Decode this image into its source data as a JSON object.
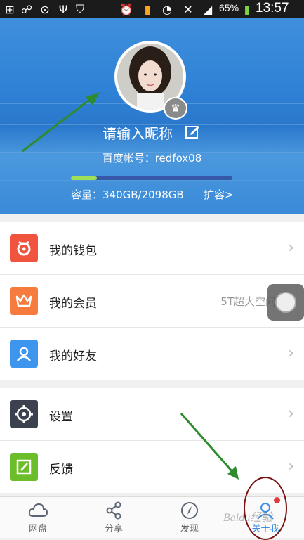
{
  "status_bar": {
    "battery_percent": "65%",
    "time": "13:57",
    "icons": [
      "plus-icon",
      "link-icon",
      "location-icon",
      "usb-icon",
      "shield-icon",
      "alarm-icon",
      "sim-icon",
      "wifi-icon",
      "mute-icon",
      "signal-icon",
      "battery-icon"
    ]
  },
  "profile": {
    "nickname_placeholder": "请输入昵称",
    "account_label": "百度帐号：redfox08",
    "storage_label": "容量：340GB/2098GB",
    "expand_label": "扩容>",
    "storage_used_fraction": 0.162
  },
  "menu": {
    "group1": [
      {
        "label": "我的钱包",
        "icon": "wallet-icon",
        "color": "#f0533e"
      },
      {
        "label": "我的会员",
        "icon": "crown-icon",
        "color": "#f77a3e",
        "extra": "5T超大空间"
      },
      {
        "label": "我的好友",
        "icon": "friend-icon",
        "color": "#3e95ee"
      }
    ],
    "group2": [
      {
        "label": "设置",
        "icon": "settings-icon",
        "color": "#3c4150"
      },
      {
        "label": "反馈",
        "icon": "feedback-icon",
        "color": "#6cbd2a"
      }
    ]
  },
  "nav": {
    "items": [
      {
        "label": "网盘",
        "icon": "cloud-icon"
      },
      {
        "label": "分享",
        "icon": "share-icon"
      },
      {
        "label": "发现",
        "icon": "compass-icon"
      },
      {
        "label": "关于我",
        "icon": "user-icon"
      }
    ],
    "active_index": 3
  },
  "watermark": "Baidu经验"
}
